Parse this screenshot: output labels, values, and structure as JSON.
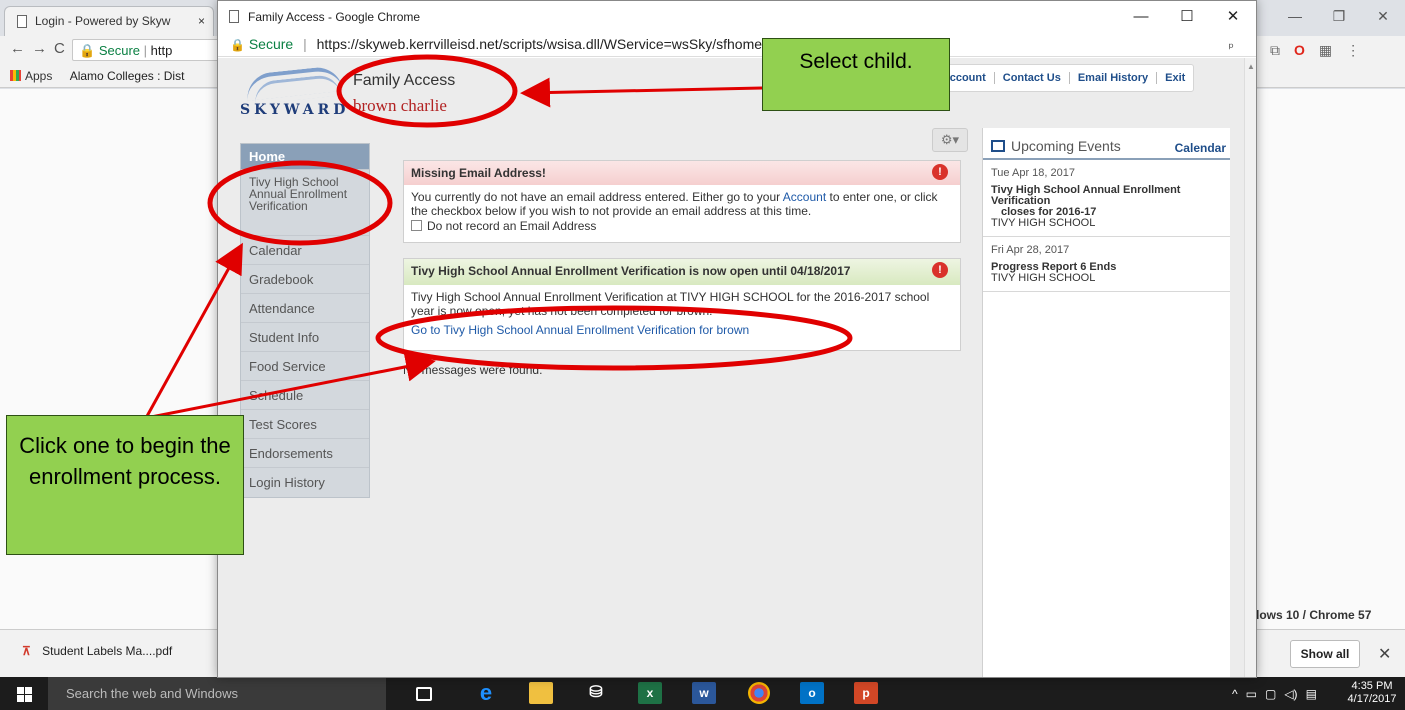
{
  "background_browser": {
    "tab1_title": "Login - Powered by Skyw",
    "tab1_close": "×",
    "url_fragment": "http",
    "secure_label": "Secure",
    "bookmarks": {
      "apps": "Apps",
      "item1": "Alamo Colleges : Dist"
    },
    "footer_note": "dows 10 / Chrome 57"
  },
  "window": {
    "title": "Family Access - Google Chrome",
    "secure_label": "Secure",
    "url": "https://skyweb.kerrvilleisd.net/scripts/wsisa.dll/WService=wsSky/sfhome"
  },
  "header": {
    "app_title": "Family Access",
    "student_name": "brown charlie",
    "logo_text": "SKYWARD",
    "links": [
      "y Account",
      "Contact Us",
      "Email History",
      "Exit"
    ]
  },
  "sidebar": {
    "items": [
      {
        "label": "Home"
      },
      {
        "label": "Tivy High School Annual Enrollment Verification"
      },
      {
        "label": "Calendar"
      },
      {
        "label": "Gradebook"
      },
      {
        "label": "Attendance"
      },
      {
        "label": "Student Info"
      },
      {
        "label": "Food Service"
      },
      {
        "label": "Schedule"
      },
      {
        "label": "Test Scores"
      },
      {
        "label": "Endorsements"
      },
      {
        "label": "Login History"
      }
    ]
  },
  "messages": {
    "m1": {
      "title": "Missing Email Address!",
      "body_a": "You currently do not have an email address entered. Either go to your ",
      "body_link": "Account",
      "body_b": " to enter one, or click the checkbox below if you wish to not provide an email address at this time.",
      "checkbox_label": "Do not record an Email Address"
    },
    "m2": {
      "title": "Tivy High School Annual Enrollment Verification is now open until 04/18/2017",
      "body": "Tivy High School Annual Enrollment Verification at TIVY HIGH SCHOOL for the 2016-2017 school year is now open, yet has not been completed for brown.",
      "link": "Go to Tivy High School Annual Enrollment Verification for brown"
    },
    "no_messages": "No messages were found."
  },
  "events": {
    "title": "Upcoming Events",
    "calendar_link": "Calendar",
    "items": [
      {
        "date": "Tue Apr 18, 2017",
        "title": "Tivy High School Annual Enrollment Verification",
        "sub": "closes for 2016-17",
        "school": "TIVY HIGH SCHOOL"
      },
      {
        "date": "Fri Apr 28, 2017",
        "title": "Progress Report 6 Ends",
        "sub": "",
        "school": "TIVY HIGH SCHOOL"
      }
    ]
  },
  "annotations": {
    "select_child": "Select child.",
    "click_one": "Click one to begin the enrollment process."
  },
  "downloads": {
    "file": "Student Labels Ma....pdf",
    "show_all": "Show all"
  },
  "taskbar": {
    "search_placeholder": "Search the web and Windows",
    "time": "4:35 PM",
    "date": "4/17/2017"
  }
}
